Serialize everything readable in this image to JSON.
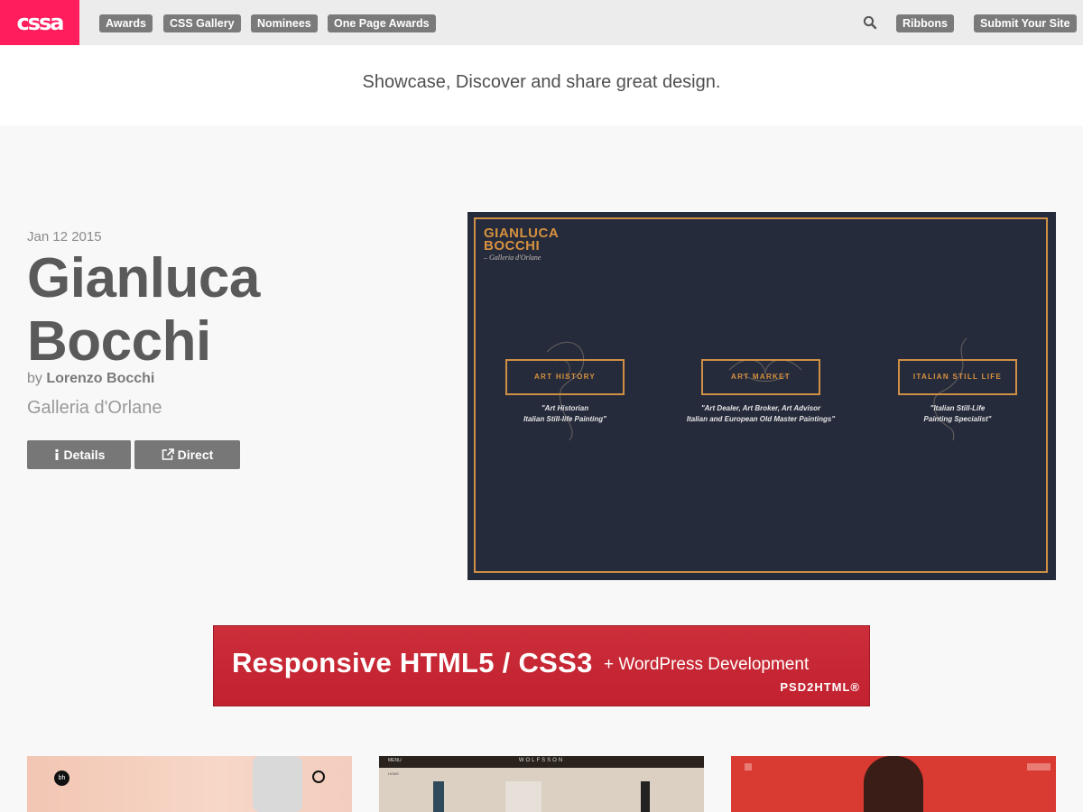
{
  "header": {
    "logo": "cssa",
    "nav": [
      "Awards",
      "CSS Gallery",
      "Nominees",
      "One Page Awards"
    ],
    "right_nav": [
      "Ribbons",
      "Submit Your Site"
    ],
    "search_icon": "search-icon"
  },
  "tagline": "Showcase, Discover and share great design.",
  "entry": {
    "date": "Jan 12 2015",
    "title_line1": "Gianluca",
    "title_line2": "Bocchi",
    "by": "by",
    "author": "Lorenzo Bocchi",
    "org": "Galleria d'Orlane",
    "details_label": "Details",
    "direct_label": "Direct",
    "details_icon": "info-icon",
    "direct_icon": "external-link-icon"
  },
  "screenshot": {
    "name_line1": "GIANLUCA",
    "name_line2": "BOCCHI",
    "subtitle": "– Galleria d'Orlane",
    "cards": [
      {
        "label": "ART HISTORY",
        "desc": "\"Art Historian\nItalian Still-life Painting\""
      },
      {
        "label": "ART MARKET",
        "desc": "\"Art Dealer, Art Broker, Art Advisor\nItalian and European Old Master Paintings\""
      },
      {
        "label": "ITALIAN STILL LIFE",
        "desc": "\"Italian Still-Life\nPainting Specialist\""
      }
    ],
    "colors": {
      "background": "#262b3b",
      "accent": "#cf8f45"
    }
  },
  "ad": {
    "main": "Responsive HTML5 / CSS3",
    "sub": "+ WordPress Development",
    "brand": "PSD2HTML®"
  },
  "thumbnails": [
    {
      "name": "bh",
      "bg": "#f0c9b8"
    },
    {
      "name": "WOLFSSON",
      "menu": "MENU",
      "home": "HOME",
      "bg": "#dcd0c2"
    },
    {
      "name": "red-portrait",
      "bg": "#d93a32"
    }
  ],
  "colors": {
    "brand": "#ff1d5e",
    "nav_button": "#7a7a7a",
    "button": "#777777"
  }
}
